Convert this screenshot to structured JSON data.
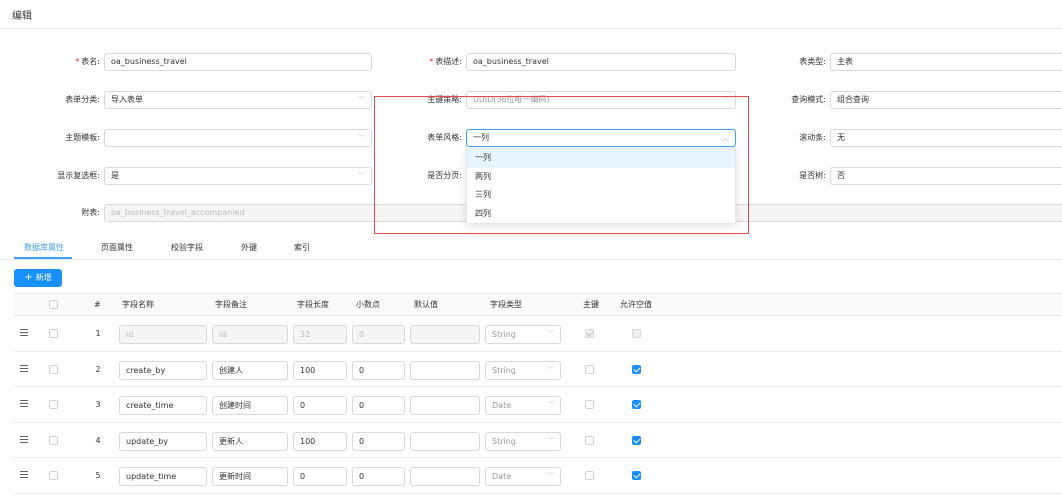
{
  "page": {
    "title": "编辑"
  },
  "form": {
    "table_name": {
      "label": "表名:",
      "value": "oa_business_travel",
      "required": true
    },
    "table_desc": {
      "label": "表描述:",
      "value": "oa_business_travel",
      "required": true
    },
    "table_type": {
      "label": "表类型:",
      "value": "主表"
    },
    "form_category": {
      "label": "表单分类:",
      "value": "导入表单"
    },
    "pk_strategy": {
      "label": "主键策略:",
      "value": "UUID(36位唯一编码)"
    },
    "query_mode": {
      "label": "查询模式:",
      "value": "组合查询"
    },
    "theme_template": {
      "label": "主题模板:",
      "value": ""
    },
    "form_style": {
      "label": "表单风格:",
      "value": "一列"
    },
    "scrollbar": {
      "label": "滚动条:",
      "value": "无"
    },
    "show_checkbox": {
      "label": "显示复选框:",
      "value": "是"
    },
    "paging": {
      "label": "是否分页:"
    },
    "is_tree": {
      "label": "是否树:",
      "value": "否"
    },
    "sub_table": {
      "label": "附表:",
      "value": "oa_business_travel_accompanied"
    }
  },
  "form_style_dropdown": {
    "options": [
      "一列",
      "两列",
      "三列",
      "四列"
    ],
    "selected": "一列"
  },
  "tabs": [
    {
      "label": "数据库属性",
      "active": true
    },
    {
      "label": "页面属性",
      "active": false
    },
    {
      "label": "校验字段",
      "active": false
    },
    {
      "label": "外键",
      "active": false
    },
    {
      "label": "索引",
      "active": false
    }
  ],
  "toolbar": {
    "add_label": "新增",
    "add_icon": "plus-icon"
  },
  "table": {
    "headers": {
      "index": "#",
      "field_name": "字段名称",
      "field_remark": "字段备注",
      "field_length": "字段长度",
      "decimal": "小数点",
      "default": "默认值",
      "field_type": "字段类型",
      "primary_key": "主键",
      "nullable": "允许空值"
    },
    "rows": [
      {
        "index": "1",
        "field_name": "id",
        "field_remark": "id",
        "field_length": "32",
        "decimal": "0",
        "default": "",
        "field_type": "String",
        "primary_key": true,
        "nullable": false,
        "locked": true
      },
      {
        "index": "2",
        "field_name": "create_by",
        "field_remark": "创建人",
        "field_length": "100",
        "decimal": "0",
        "default": "",
        "field_type": "String",
        "primary_key": false,
        "nullable": true,
        "locked": false
      },
      {
        "index": "3",
        "field_name": "create_time",
        "field_remark": "创建时间",
        "field_length": "0",
        "decimal": "0",
        "default": "",
        "field_type": "Date",
        "primary_key": false,
        "nullable": true,
        "locked": false
      },
      {
        "index": "4",
        "field_name": "update_by",
        "field_remark": "更新人",
        "field_length": "100",
        "decimal": "0",
        "default": "",
        "field_type": "String",
        "primary_key": false,
        "nullable": true,
        "locked": false
      },
      {
        "index": "5",
        "field_name": "update_time",
        "field_remark": "更新时间",
        "field_length": "0",
        "decimal": "0",
        "default": "",
        "field_type": "Date",
        "primary_key": false,
        "nullable": true,
        "locked": false
      }
    ]
  },
  "colors": {
    "accent": "#1890ff",
    "active_tab": "#409eff",
    "required": "#f5222d",
    "highlight_box": "#e64b4b"
  }
}
